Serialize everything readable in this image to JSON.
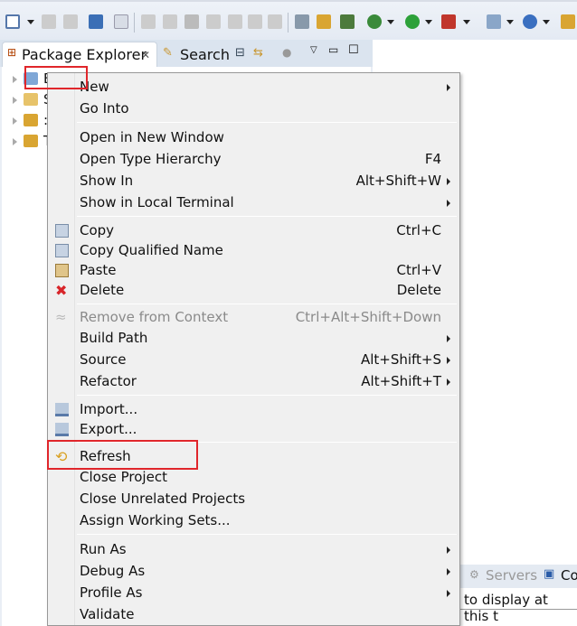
{
  "toolbar": {
    "icons": [
      "new-wizard-icon",
      "save-icon",
      "save-all-icon",
      "console-icon",
      "skip-breakpoints-icon",
      "resume-icon",
      "suspend-icon",
      "terminate-icon",
      "disconnect-icon",
      "step-into-icon",
      "step-over-icon",
      "step-return-icon",
      "next-annotation-icon",
      "prev-annotation-icon",
      "external-tools-icon",
      "debug-icon",
      "run-icon",
      "coverage-icon",
      "new-server-icon",
      "spring-icon"
    ]
  },
  "views": {
    "package_explorer": "Package Explorer",
    "search": "Search"
  },
  "tree": {
    "items": [
      {
        "label": "B",
        "icon": "project-icon"
      },
      {
        "label": "S",
        "icon": "folder-icon"
      },
      {
        "label": ":",
        "icon": "maven-project-icon"
      },
      {
        "label": "T",
        "icon": "maven-project-icon"
      }
    ]
  },
  "bottom": {
    "servers_tab": "Servers",
    "console_tab": "Co",
    "console_text": "to display at this t"
  },
  "menu": {
    "items": [
      {
        "label": "New",
        "submenu": true
      },
      {
        "label": "Go Into"
      },
      {
        "label": "Open in New Window"
      },
      {
        "label": "Open Type Hierarchy",
        "shortcut": "F4"
      },
      {
        "label": "Show In",
        "shortcut": "Alt+Shift+W",
        "submenu": true
      },
      {
        "label": "Show in Local Terminal",
        "submenu": true
      },
      {
        "label": "Copy",
        "shortcut": "Ctrl+C",
        "icon": "copy-icon"
      },
      {
        "label": "Copy Qualified Name",
        "icon": "copy-qualified-icon"
      },
      {
        "label": "Paste",
        "shortcut": "Ctrl+V",
        "icon": "paste-icon"
      },
      {
        "label": "Delete",
        "shortcut": "Delete",
        "icon": "delete-icon"
      },
      {
        "label": "Remove from Context",
        "shortcut": "Ctrl+Alt+Shift+Down",
        "disabled": true,
        "icon": "remove-context-icon"
      },
      {
        "label": "Build Path",
        "submenu": true
      },
      {
        "label": "Source",
        "shortcut": "Alt+Shift+S",
        "submenu": true
      },
      {
        "label": "Refactor",
        "shortcut": "Alt+Shift+T",
        "submenu": true
      },
      {
        "label": "Import...",
        "icon": "import-icon"
      },
      {
        "label": "Export...",
        "icon": "export-icon"
      },
      {
        "label": "Refresh",
        "icon": "refresh-icon",
        "highlighted": true
      },
      {
        "label": "Close Project"
      },
      {
        "label": "Close Unrelated Projects"
      },
      {
        "label": "Assign Working Sets..."
      },
      {
        "label": "Run As",
        "submenu": true
      },
      {
        "label": "Debug As",
        "submenu": true
      },
      {
        "label": "Profile As",
        "submenu": true
      },
      {
        "label": "Validate"
      }
    ]
  },
  "colors": {
    "highlight_box": "#e0262b",
    "menu_bg": "#f0f0f0"
  }
}
